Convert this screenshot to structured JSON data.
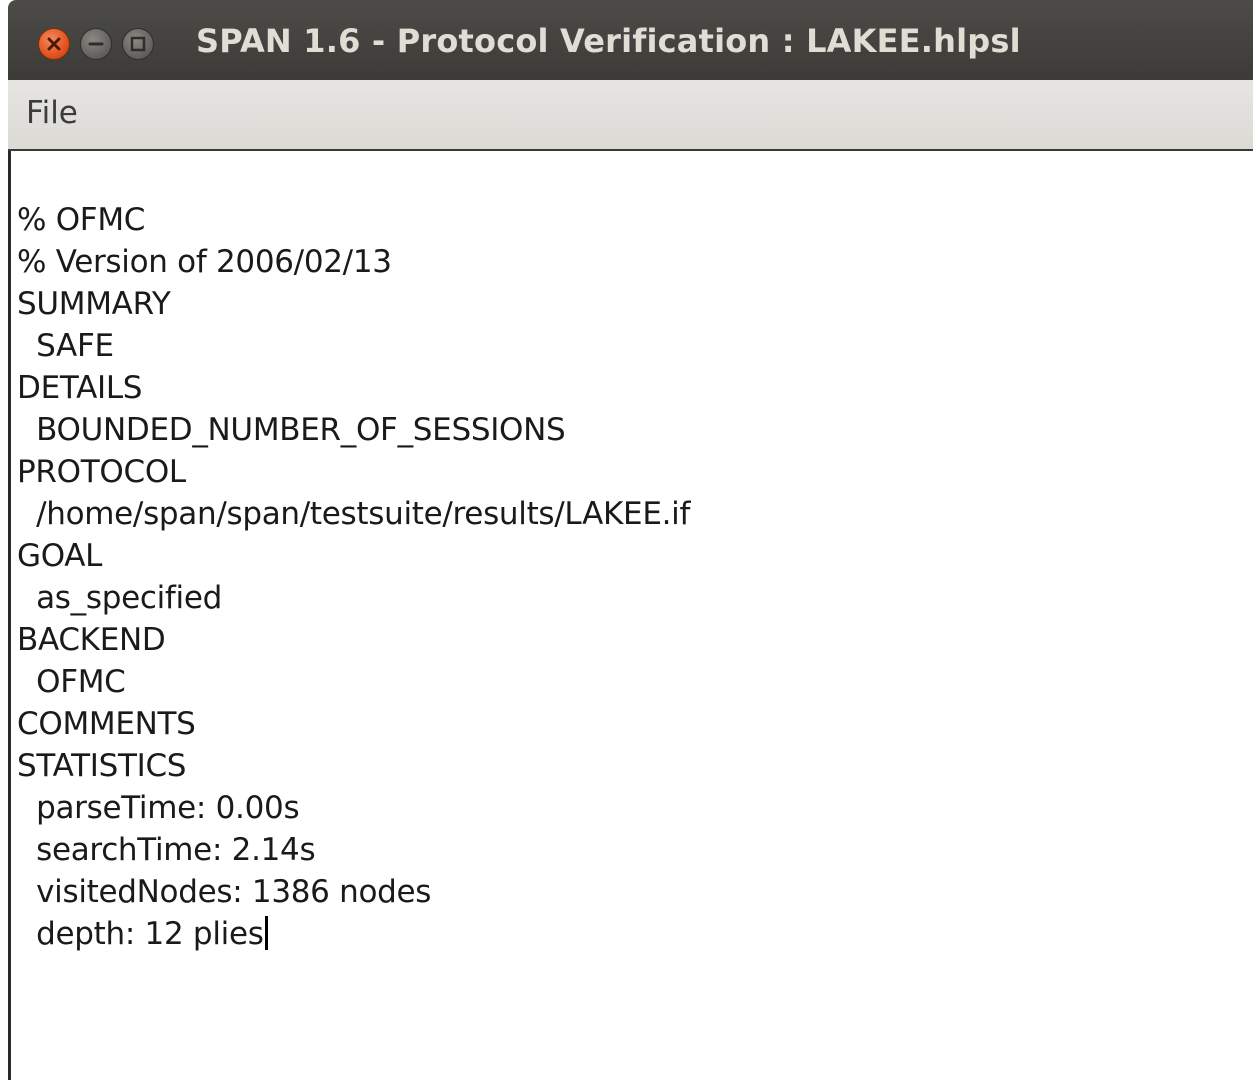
{
  "window": {
    "title": "SPAN 1.6 - Protocol Verification : LAKEE.hlpsl",
    "buttons": [
      "close-icon",
      "minimize-icon",
      "maximize-icon"
    ]
  },
  "menu": {
    "file_label": "File"
  },
  "output": {
    "lines": [
      "% OFMC",
      "% Version of 2006/02/13",
      "SUMMARY",
      "  SAFE",
      "DETAILS",
      "  BOUNDED_NUMBER_OF_SESSIONS",
      "PROTOCOL",
      "  /home/span/span/testsuite/results/LAKEE.if",
      "GOAL",
      "  as_specified",
      "BACKEND",
      "  OFMC",
      "COMMENTS",
      "STATISTICS",
      "  parseTime: 0.00s",
      "  searchTime: 2.14s",
      "  visitedNodes: 1386 nodes",
      "  depth: 12 plies"
    ]
  },
  "colors": {
    "titlebar": "#3c3b37",
    "title_text": "#e0ddd5",
    "close_button": "#e2531d",
    "menubar": "#dcdad5"
  }
}
